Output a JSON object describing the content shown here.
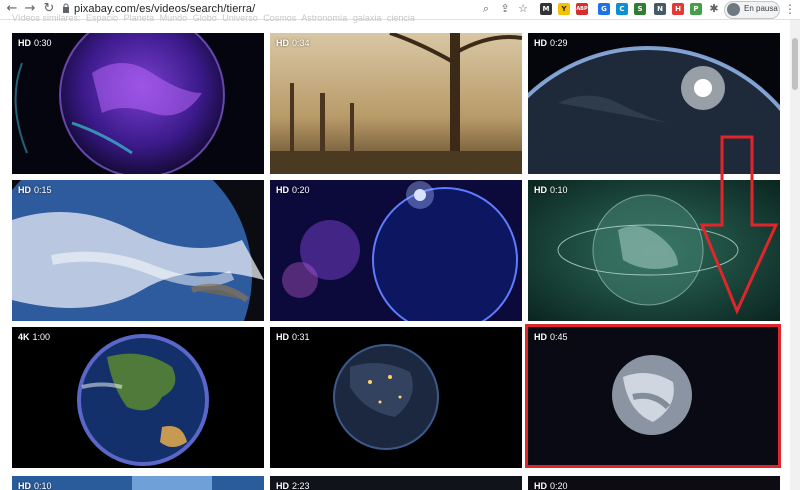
{
  "browser": {
    "url": "pixabay.com/es/videos/search/tierra/",
    "profile_label": "En pausa",
    "extensions": [
      "M",
      "Y",
      "ABP",
      "G",
      "C",
      "S",
      "N",
      "H",
      "P",
      "Z"
    ]
  },
  "related": {
    "label": "Vídeos similares:",
    "tags": [
      "Espacio",
      "Planeta",
      "Mundo",
      "Globo",
      "Universo",
      "Cosmos",
      "Astronomía",
      "galaxia",
      "ciencia"
    ]
  },
  "videos": [
    {
      "quality": "HD",
      "duration": "0:30"
    },
    {
      "quality": "HD",
      "duration": "0:34"
    },
    {
      "quality": "HD",
      "duration": "0:29"
    },
    {
      "quality": "HD",
      "duration": "0:15"
    },
    {
      "quality": "HD",
      "duration": "0:20"
    },
    {
      "quality": "HD",
      "duration": "0:10"
    },
    {
      "quality": "4K",
      "duration": "1:00"
    },
    {
      "quality": "HD",
      "duration": "0:31"
    },
    {
      "quality": "HD",
      "duration": "0:45"
    },
    {
      "quality": "HD",
      "duration": "0:10"
    },
    {
      "quality": "HD",
      "duration": "2:23"
    },
    {
      "quality": "HD",
      "duration": "0:20"
    }
  ],
  "annotation": {
    "color": "#e0252b"
  }
}
